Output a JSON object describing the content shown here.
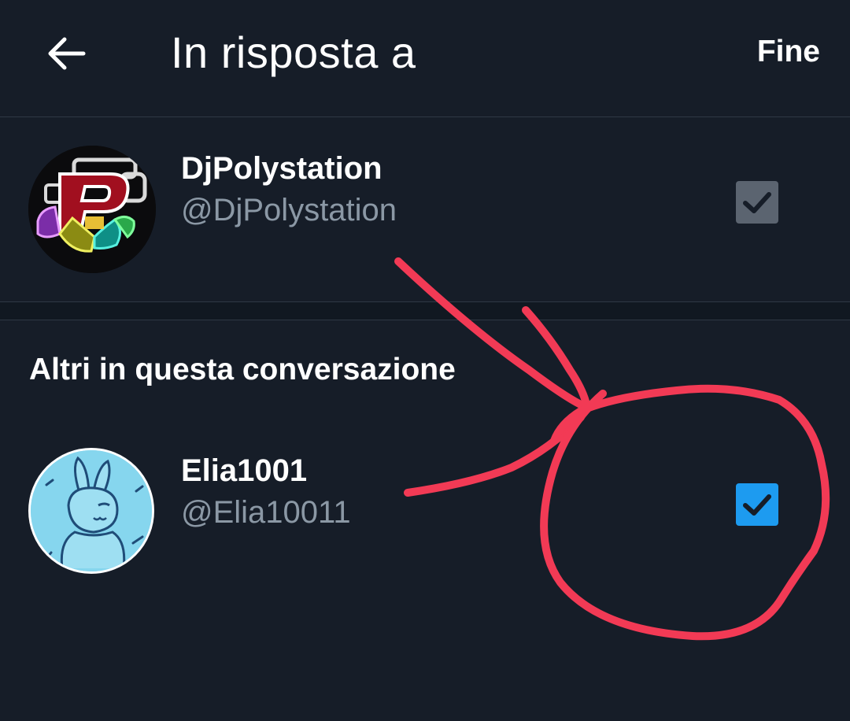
{
  "header": {
    "title": "In risposta a",
    "done_label": "Fine",
    "back_icon": "arrow-left-icon"
  },
  "primary_user": {
    "name": "DjPolystation",
    "handle": "@DjPolystation",
    "checked": true,
    "checkbox_state": "checked-disabled"
  },
  "section": {
    "title": "Altri in questa conversazione"
  },
  "others": [
    {
      "name": "Elia1001",
      "handle": "@Elia10011",
      "checked": true,
      "checkbox_state": "checked-active"
    }
  ],
  "colors": {
    "background": "#161d28",
    "divider": "#2f3844",
    "text_primary": "#ffffff",
    "text_secondary": "#8b98a5",
    "checkbox_disabled": "#5b6470",
    "checkbox_active": "#1d9bf0",
    "annotation": "#f23a55"
  }
}
